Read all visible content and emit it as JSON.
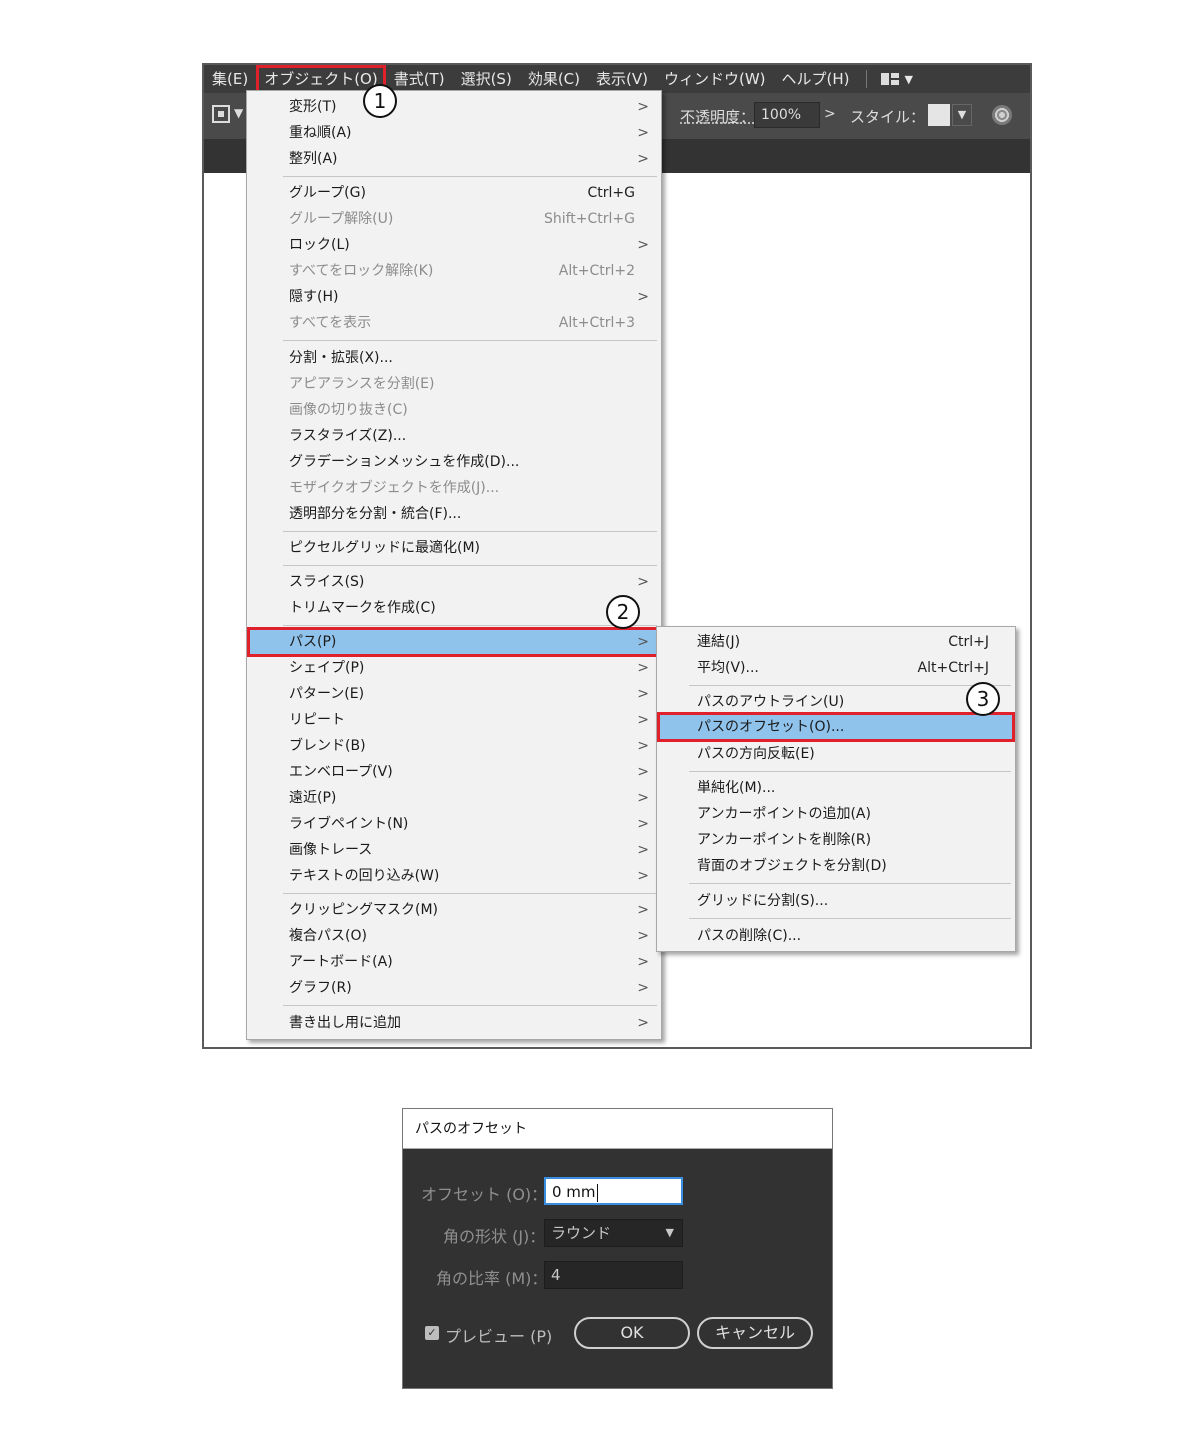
{
  "menubar": {
    "items": [
      "集(E)",
      "オブジェクト(O)",
      "書式(T)",
      "選択(S)",
      "効果(C)",
      "表示(V)",
      "ウィンドウ(W)",
      "ヘルプ(H)"
    ]
  },
  "controlbar": {
    "opacity_label": "不透明度：",
    "opacity_value": "100%",
    "style_label": "スタイル："
  },
  "object_menu": {
    "items": [
      {
        "label": "変形(T)",
        "submenu": true
      },
      {
        "label": "重ね順(A)",
        "submenu": true
      },
      {
        "label": "整列(A)",
        "submenu": true
      },
      {
        "label": "グループ(G)",
        "shortcut": "Ctrl+G"
      },
      {
        "label": "グループ解除(U)",
        "shortcut": "Shift+Ctrl+G",
        "disabled": true
      },
      {
        "label": "ロック(L)",
        "submenu": true
      },
      {
        "label": "すべてをロック解除(K)",
        "shortcut": "Alt+Ctrl+2",
        "disabled": true
      },
      {
        "label": "隠す(H)",
        "submenu": true
      },
      {
        "label": "すべてを表示",
        "shortcut": "Alt+Ctrl+3",
        "disabled": true
      },
      {
        "label": "分割・拡張(X)..."
      },
      {
        "label": "アピアランスを分割(E)",
        "disabled": true
      },
      {
        "label": "画像の切り抜き(C)",
        "disabled": true
      },
      {
        "label": "ラスタライズ(Z)..."
      },
      {
        "label": "グラデーションメッシュを作成(D)..."
      },
      {
        "label": "モザイクオブジェクトを作成(J)...",
        "disabled": true
      },
      {
        "label": "透明部分を分割・統合(F)..."
      },
      {
        "label": "ピクセルグリッドに最適化(M)"
      },
      {
        "label": "スライス(S)",
        "submenu": true
      },
      {
        "label": "トリムマークを作成(C)"
      },
      {
        "label": "パス(P)",
        "submenu": true,
        "highlighted": true
      },
      {
        "label": "シェイプ(P)",
        "submenu": true
      },
      {
        "label": "パターン(E)",
        "submenu": true
      },
      {
        "label": "リピート",
        "submenu": true
      },
      {
        "label": "ブレンド(B)",
        "submenu": true
      },
      {
        "label": "エンベロープ(V)",
        "submenu": true
      },
      {
        "label": "遠近(P)",
        "submenu": true
      },
      {
        "label": "ライブペイント(N)",
        "submenu": true
      },
      {
        "label": "画像トレース",
        "submenu": true
      },
      {
        "label": "テキストの回り込み(W)",
        "submenu": true
      },
      {
        "label": "クリッピングマスク(M)",
        "submenu": true
      },
      {
        "label": "複合パス(O)",
        "submenu": true
      },
      {
        "label": "アートボード(A)",
        "submenu": true
      },
      {
        "label": "グラフ(R)",
        "submenu": true
      },
      {
        "label": "書き出し用に追加",
        "submenu": true
      }
    ]
  },
  "path_menu": {
    "items": [
      {
        "label": "連結(J)",
        "shortcut": "Ctrl+J"
      },
      {
        "label": "平均(V)...",
        "shortcut": "Alt+Ctrl+J"
      },
      {
        "label": "パスのアウトライン(U)"
      },
      {
        "label": "パスのオフセット(O)...",
        "highlighted": true
      },
      {
        "label": "パスの方向反転(E)"
      },
      {
        "label": "単純化(M)..."
      },
      {
        "label": "アンカーポイントの追加(A)"
      },
      {
        "label": "アンカーポイントを削除(R)"
      },
      {
        "label": "背面のオブジェクトを分割(D)"
      },
      {
        "label": "グリッドに分割(S)..."
      },
      {
        "label": "パスの削除(C)..."
      }
    ]
  },
  "badges": [
    "1",
    "2",
    "3"
  ],
  "dialog": {
    "title": "パスのオフセット",
    "offset_label": "オフセット (O)：",
    "offset_value": "0 mm",
    "corner_label": "角の形状 (J)：",
    "corner_value": "ラウンド",
    "ratio_label": "角の比率 (M)：",
    "ratio_value": "4",
    "preview_label": "プレビュー (P)",
    "preview_checked": true,
    "ok_label": "OK",
    "cancel_label": "キャンセル"
  },
  "colors": {
    "highlight": "#90c3ec",
    "callout_red": "#e0202a",
    "menubar_bg": "#3c3c3c",
    "dialog_bg": "#323232"
  }
}
